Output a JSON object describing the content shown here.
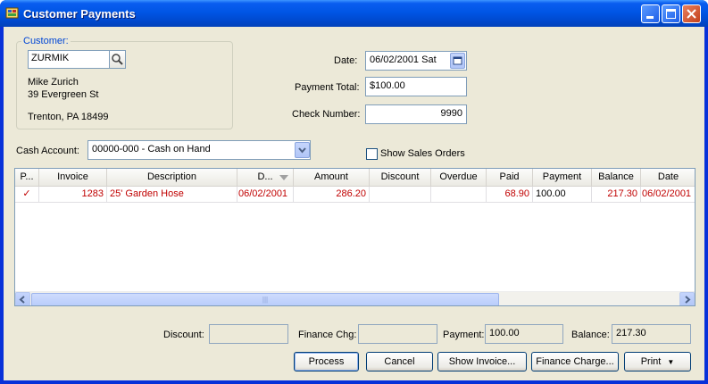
{
  "window": {
    "title": "Customer Payments"
  },
  "customer": {
    "legend": "Customer:",
    "code": "ZURMIK",
    "name": "Mike Zurich",
    "address1": "39 Evergreen St",
    "address2": "Trenton, PA 18499"
  },
  "form": {
    "date_label": "Date:",
    "date_value": "06/02/2001 Sat",
    "payment_total_label": "Payment Total:",
    "payment_total_value": "$100.00",
    "check_number_label": "Check Number:",
    "check_number_value": "9990",
    "cash_account_label": "Cash Account:",
    "cash_account_value": "00000-000 - Cash on Hand",
    "show_sales_orders_label": "Show Sales Orders"
  },
  "grid": {
    "columns": [
      "P...",
      "Invoice",
      "Description",
      "D...",
      "Amount",
      "Discount",
      "Overdue",
      "Paid",
      "Payment",
      "Balance",
      "Date"
    ],
    "rows": [
      {
        "p": "✓",
        "invoice": "1283",
        "description": "25' Garden Hose",
        "d": "06/02/2001",
        "amount": "286.20",
        "discount": "",
        "overdue": "",
        "paid": "68.90",
        "payment": "100.00",
        "balance": "217.30",
        "date": "06/02/2001"
      }
    ]
  },
  "totals": {
    "discount_label": "Discount:",
    "discount_value": "",
    "finance_chg_label": "Finance Chg:",
    "finance_chg_value": "",
    "payment_label": "Payment:",
    "payment_value": "100.00",
    "balance_label": "Balance:",
    "balance_value": "217.30"
  },
  "buttons": {
    "process": "Process",
    "cancel": "Cancel",
    "show_invoice": "Show Invoice...",
    "finance_charge": "Finance Charge...",
    "print": "Print"
  },
  "colors": {
    "titlebar": "#0055e5",
    "row_text": "#c00000",
    "face": "#ece9d8"
  }
}
